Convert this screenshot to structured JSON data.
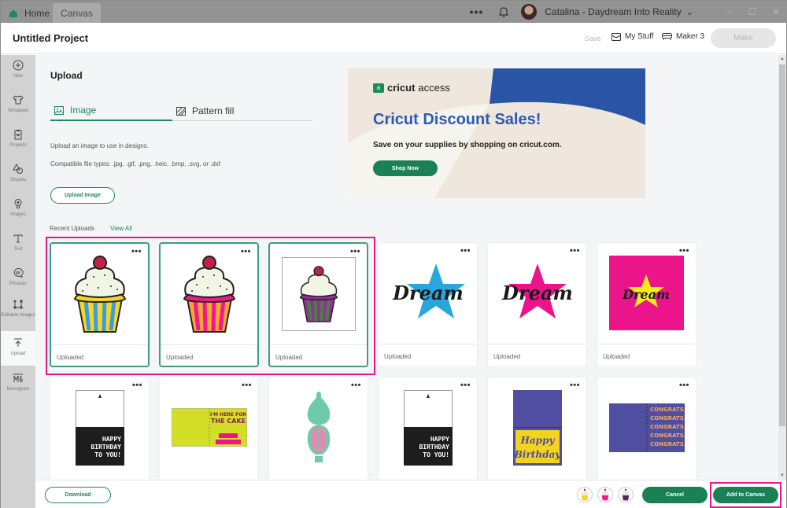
{
  "titlebar": {
    "home_tab": "Home",
    "canvas_tab": "Canvas",
    "more": "•••",
    "user": "Catalina - Daydream Into Reality",
    "window_controls": [
      "–",
      "☐",
      "✕"
    ]
  },
  "header": {
    "project_title": "Untitled Project",
    "save": "Save",
    "my_stuff": "My Stuff",
    "machine": "Maker 3",
    "make": "Make"
  },
  "sidebar": {
    "items": [
      {
        "label": "New",
        "icon": "plus-circle-icon"
      },
      {
        "label": "Templates",
        "icon": "tshirt-icon"
      },
      {
        "label": "Projects",
        "icon": "clipboard-icon"
      },
      {
        "label": "Shapes",
        "icon": "shapes-icon"
      },
      {
        "label": "Images",
        "icon": "lightbulb-icon"
      },
      {
        "label": "Text",
        "icon": "text-icon"
      },
      {
        "label": "Phrases",
        "icon": "speech-bubble-icon"
      },
      {
        "label": "Editable Images",
        "icon": "editable-image-icon"
      },
      {
        "label": "Upload",
        "icon": "upload-icon",
        "active": true
      },
      {
        "label": "Monogram",
        "icon": "monogram-icon"
      }
    ]
  },
  "upload": {
    "title": "Upload",
    "tabs": [
      {
        "label": "Image",
        "active": true
      },
      {
        "label": "Pattern fill",
        "active": false
      }
    ],
    "description": "Upload an image to use in designs.",
    "file_types": "Compatible file types: .jpg, .gif, .png, .heic, .bmp, .svg, or .dxf",
    "upload_button": "Upload Image",
    "recent_label": "Recent Uploads",
    "view_all": "View All"
  },
  "banner": {
    "brand_bold": "cricut",
    "brand_light": "access",
    "title": "Cricut Discount Sales!",
    "subtitle": "Save on your supplies by shopping on cricut.com.",
    "button": "Shop Now"
  },
  "uploads": [
    {
      "name": "cupcake-yellow-blue",
      "status": "Uploaded",
      "selected": true
    },
    {
      "name": "cupcake-pink-orange",
      "status": "Uploaded",
      "selected": true
    },
    {
      "name": "cupcake-purple-green",
      "status": "Uploaded",
      "selected": true
    },
    {
      "name": "dream-blue-star",
      "status": "Uploaded",
      "selected": false
    },
    {
      "name": "dream-pink-star",
      "status": "Uploaded",
      "selected": false
    },
    {
      "name": "dream-yellow-star-pink-square",
      "status": "Uploaded",
      "selected": false
    },
    {
      "name": "happy-birthday-card",
      "text": "HAPPY BIRTHDAY TO YOU!"
    },
    {
      "name": "here-for-the-cake-card",
      "text": "I'M HERE FOR THE CAKE"
    },
    {
      "name": "hot-air-balloon-ornament"
    },
    {
      "name": "happy-birthday-card-2",
      "text": "HAPPY BIRTHDAY TO YOU!"
    },
    {
      "name": "happy-birthday-script-card",
      "text": "Happy Birthday"
    },
    {
      "name": "congrats-card",
      "text": "CONGRATS."
    }
  ],
  "card_menu": "•••",
  "footer": {
    "download": "Download",
    "selected_count": 3,
    "cancel": "Cancel",
    "add_to_canvas": "Add to Canvas"
  },
  "colors": {
    "accent_green": "#1a8056",
    "highlight_pink": "#e9138b",
    "banner_blue": "#2d5ab2"
  }
}
